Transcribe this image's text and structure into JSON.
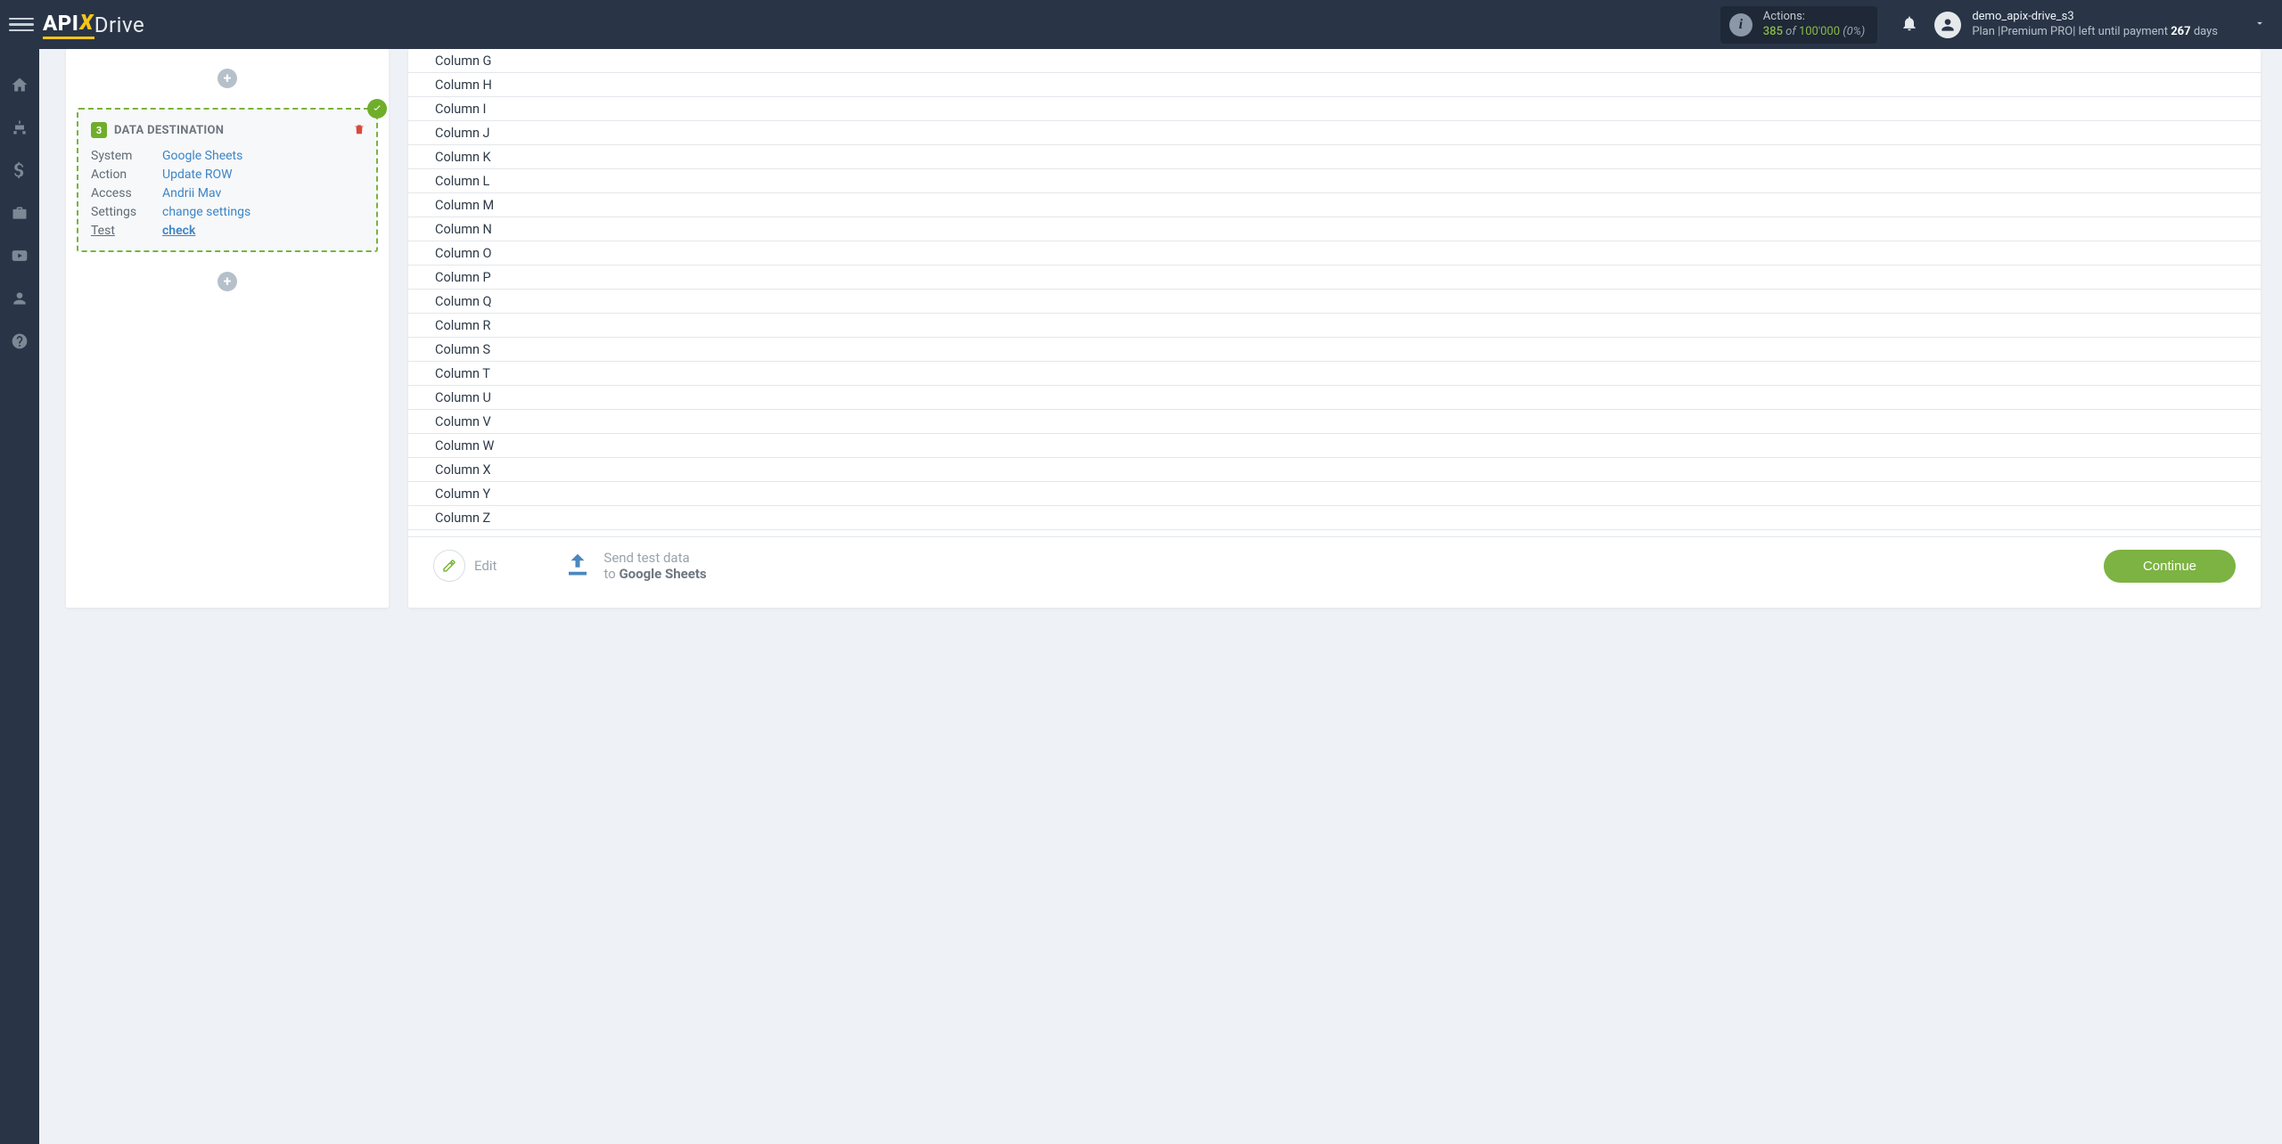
{
  "topbar": {
    "logo_api": "API",
    "logo_x": "X",
    "logo_drive": "Drive",
    "actions": {
      "label": "Actions:",
      "count": "385",
      "of": " of ",
      "total": "100'000",
      "pct": "(0%)"
    },
    "user": {
      "name": "demo_apix-drive_s3",
      "plan_prefix": "Plan |",
      "plan_name": "Premium PRO",
      "plan_mid": "| left until payment ",
      "days": "267",
      "days_suffix": " days"
    }
  },
  "destination": {
    "step_num": "3",
    "title": "DATA DESTINATION",
    "rows": {
      "system_k": "System",
      "system_v": "Google Sheets",
      "action_k": "Action",
      "action_v": "Update ROW",
      "access_k": "Access",
      "access_v": "Andrii Mav",
      "settings_k": "Settings",
      "settings_v": "change settings",
      "test_k": "Test",
      "test_v": "check"
    }
  },
  "columns": [
    "Column G",
    "Column H",
    "Column I",
    "Column J",
    "Column K",
    "Column L",
    "Column M",
    "Column N",
    "Column O",
    "Column P",
    "Column Q",
    "Column R",
    "Column S",
    "Column T",
    "Column U",
    "Column V",
    "Column W",
    "Column X",
    "Column Y",
    "Column Z"
  ],
  "bottom": {
    "edit": "Edit",
    "send_line1": "Send test data",
    "send_to": "to ",
    "send_target": "Google Sheets",
    "continue": "Continue"
  }
}
